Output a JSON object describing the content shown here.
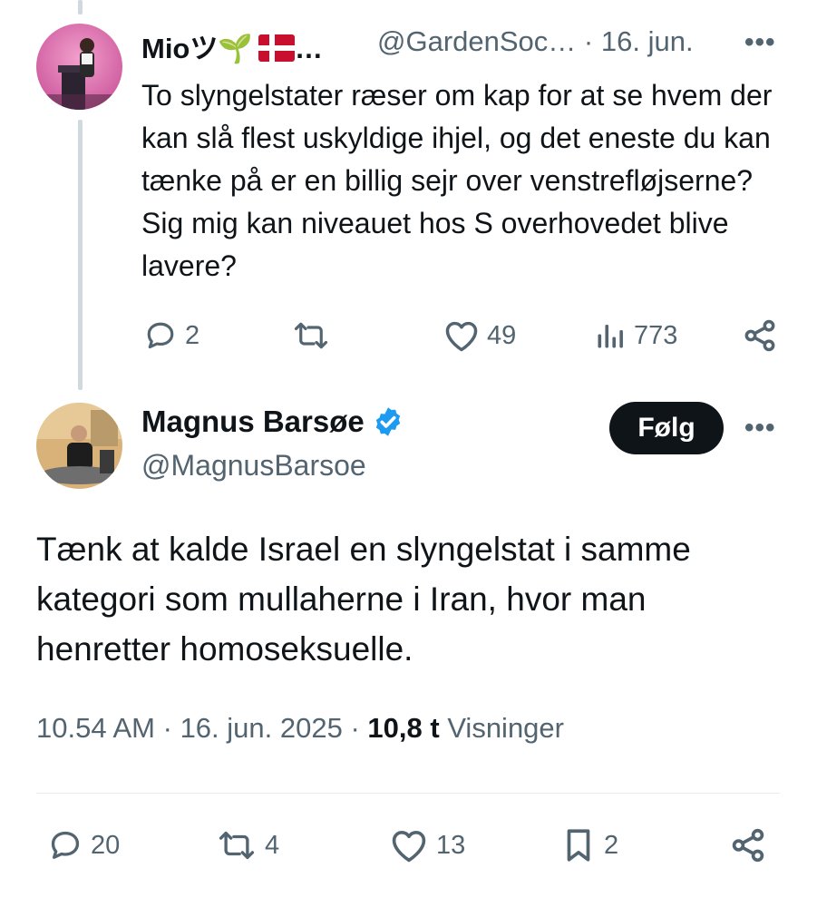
{
  "reply": {
    "display_name": "Mioツ🌱",
    "name_ellipsis": "…",
    "handle": "@GardenSoc…",
    "separator": "·",
    "date": "16. jun.",
    "more_label": "•••",
    "text": "To slyngelstater ræser om kap for at se hvem der kan slå flest uskyldige ihjel, og det eneste du kan tænke på er en billig sejr over venstrefløjserne? Sig mig kan niveauet hos S overhovedet blive lavere?",
    "stats": {
      "replies": "2",
      "retweets": "",
      "likes": "49",
      "views": "773"
    },
    "icons": [
      "reply-icon",
      "retweet-icon",
      "like-icon",
      "views-icon",
      "share-icon"
    ]
  },
  "main": {
    "display_name": "Magnus Barsøe",
    "handle": "@MagnusBarsoe",
    "follow_label": "Følg",
    "more_label": "•••",
    "text": "Tænk at kalde Israel en slyngelstat i samme kategori som mullaherne i Iran, hvor man henretter homoseksuelle.",
    "time": "10.54 AM",
    "separator": "·",
    "date": "16. jun. 2025",
    "views_count": "10,8 t",
    "views_label": "Visninger",
    "stats": {
      "replies": "20",
      "retweets": "4",
      "likes": "13",
      "bookmarks": "2"
    },
    "icons": [
      "reply-icon",
      "retweet-icon",
      "like-icon",
      "bookmark-icon",
      "share-icon"
    ]
  },
  "colors": {
    "text": "#0f1419",
    "muted": "#536471",
    "verified": "#1d9bf0",
    "button_bg": "#0f1419",
    "thread_line": "#cfd9de"
  }
}
